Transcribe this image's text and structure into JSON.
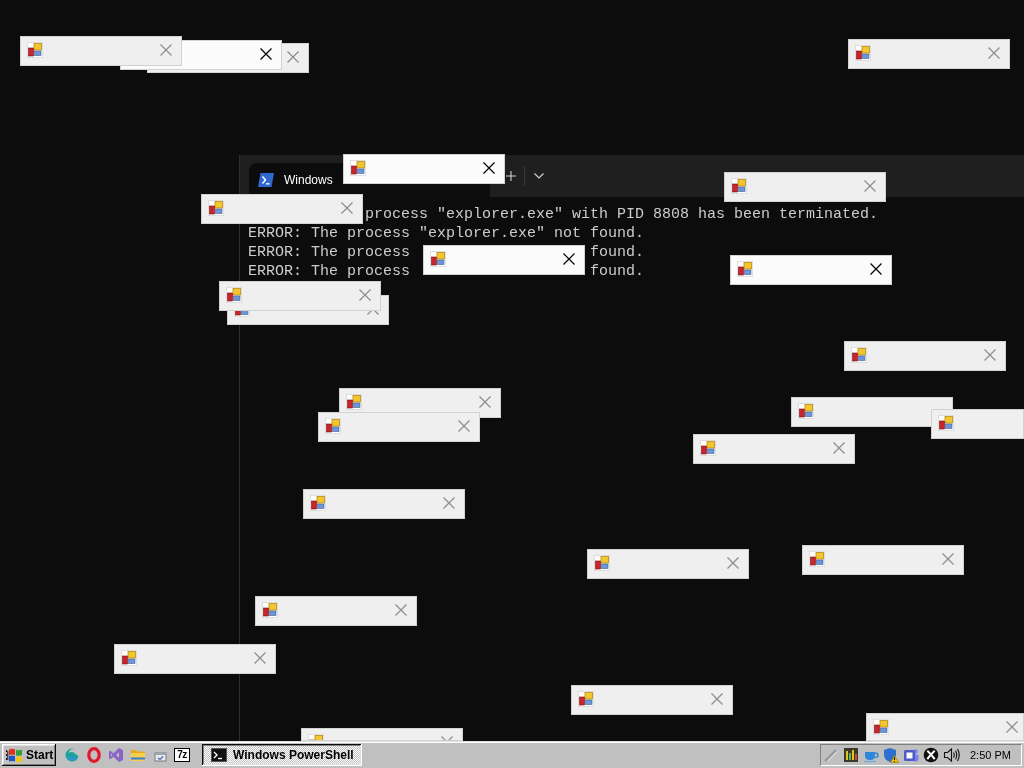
{
  "terminal_window": {
    "tab": {
      "title": "Windows",
      "selected": true
    },
    "lines": [
      [
        "process \"explorer.exe\" with PID 8808 has been terminated."
      ],
      [
        "ERROR: The process \"explorer.exe\" not found."
      ],
      [
        "ERROR: The process",
        "found."
      ],
      [
        "ERROR: The process",
        "found."
      ]
    ]
  },
  "popup_windows": [
    {
      "active": false
    },
    {
      "active": true
    },
    {
      "active": false
    },
    {
      "active": false
    },
    {
      "active": true
    },
    {
      "active": false
    },
    {
      "active": false
    },
    {
      "active": true
    },
    {
      "active": true
    },
    {
      "active": false
    },
    {
      "active": false
    },
    {
      "active": false
    },
    {
      "active": false
    },
    {
      "active": false
    },
    {
      "active": false
    },
    {
      "active": false
    },
    {
      "active": false
    },
    {
      "active": false
    },
    {
      "active": false
    },
    {
      "active": false
    },
    {
      "active": false
    },
    {
      "active": false
    },
    {
      "active": false
    },
    {
      "active": false
    },
    {
      "active": false
    }
  ],
  "taskbar": {
    "start_button": "Start",
    "launcher_text": "7z",
    "tasks": [
      {
        "title": "Windows PowerShell",
        "selected": true
      }
    ],
    "clock": "2:50 PM"
  }
}
